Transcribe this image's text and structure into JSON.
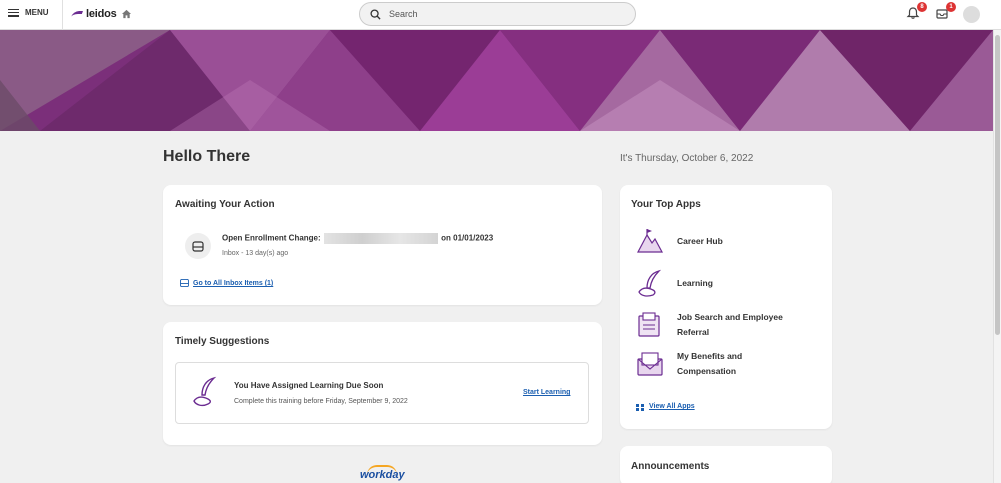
{
  "topbar": {
    "menu_label": "MENU",
    "logo_text": "leidos",
    "search_placeholder": "Search",
    "notifications_count": "8",
    "inbox_count": "1"
  },
  "greeting": "Hello There",
  "date_text": "It's Thursday, October 6, 2022",
  "awaiting": {
    "title": "Awaiting Your Action",
    "item_title_prefix": "Open Enrollment Change:",
    "item_title_suffix": "on 01/01/2023",
    "item_sub": "Inbox - 13 day(s) ago",
    "link_label": "Go to All Inbox Items (1)"
  },
  "suggestions": {
    "title": "Timely Suggestions",
    "item_title": "You Have Assigned Learning Due Soon",
    "item_sub": "Complete this training before Friday, September 9, 2022",
    "action_label": "Start Learning"
  },
  "top_apps": {
    "title": "Your Top Apps",
    "apps": [
      {
        "label_line1": "Career Hub",
        "label_line2": ""
      },
      {
        "label_line1": "Learning",
        "label_line2": ""
      },
      {
        "label_line1": "Job Search and Employee",
        "label_line2": "Referral"
      },
      {
        "label_line1": "My Benefits and",
        "label_line2": "Compensation"
      }
    ],
    "view_all_label": "View All Apps"
  },
  "announcements": {
    "title": "Announcements"
  },
  "footer": {
    "logo_text": "workday"
  },
  "colors": {
    "brand_purple": "#7a2e78",
    "link_blue": "#1a5eb0",
    "badge_red": "#dd3333"
  }
}
